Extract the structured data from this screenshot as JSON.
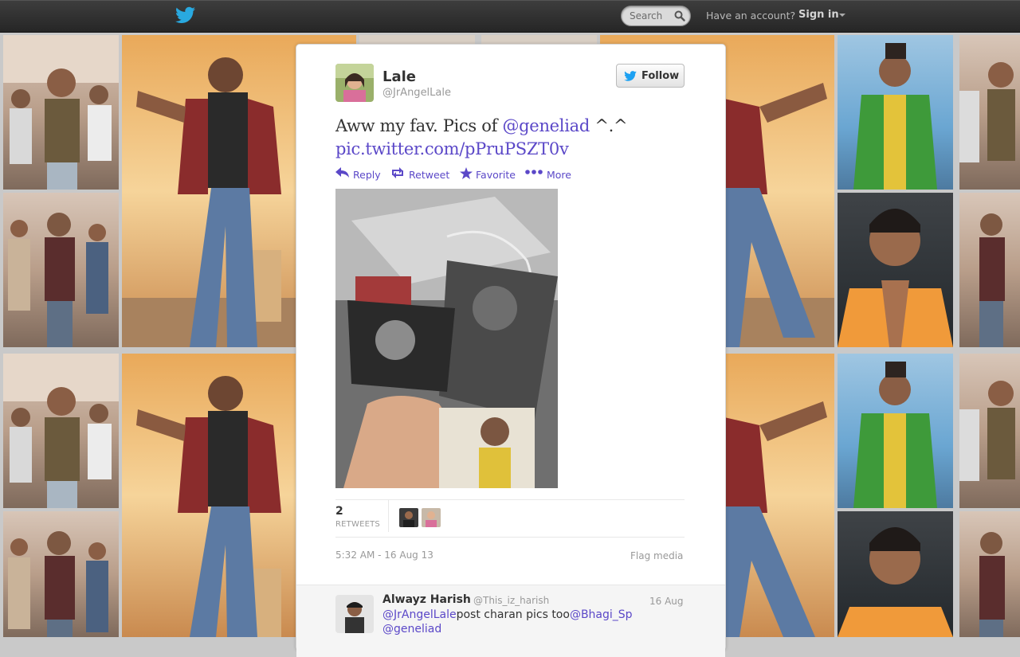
{
  "topbar": {
    "search_placeholder": "Search",
    "have_account": "Have an account?",
    "sign_in": "Sign in"
  },
  "tweet": {
    "display_name": "Lale",
    "screen_name": "@JrAngelLale",
    "follow_label": "Follow",
    "text_prefix": "Aww my fav. Pics of ",
    "mention": "@geneliad",
    "text_suffix": " ^.^",
    "link": "pic.twitter.com/pPruPSZT0v",
    "actions": {
      "reply": "Reply",
      "retweet": "Retweet",
      "favorite": "Favorite",
      "more": "More"
    },
    "retweets_count": "2",
    "retweets_label": "RETWEETS",
    "timestamp": "5:32 AM - 16 Aug 13",
    "flag_media": "Flag media"
  },
  "reply": {
    "name": "Alwayz Harish",
    "handle": "@This_iz_harish",
    "date": "16 Aug",
    "mention1": "@JrAngelLale",
    "text": "post charan pics too",
    "mention2": "@Bhagi_Sp",
    "mention3": "@geneliad"
  },
  "colors": {
    "link": "#5b48c8",
    "twitter_blue": "#1da1f2",
    "topbar": "#2d2d2d"
  },
  "icons": [
    "twitter-bird-icon",
    "search-icon",
    "reply-icon",
    "retweet-icon",
    "favorite-star-icon",
    "more-dots-icon"
  ]
}
